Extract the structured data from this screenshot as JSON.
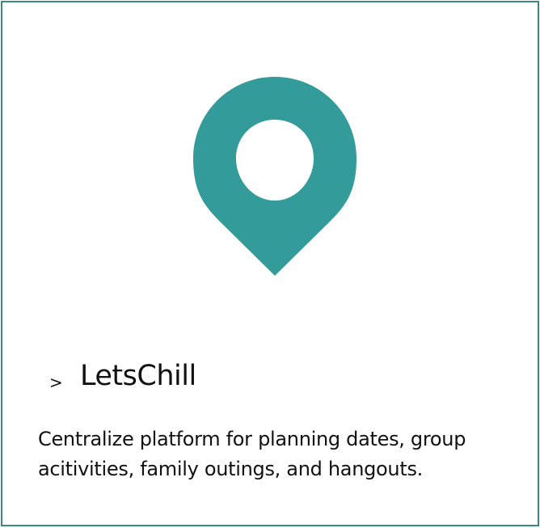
{
  "card": {
    "icon": "map-pin-icon",
    "chevron": ">",
    "title": "LetsChill",
    "description": "Centralize platform for planning dates, group acitivities, family outings, and hangouts."
  },
  "colors": {
    "accent": "#339b99",
    "border": "#3a8a80",
    "text": "#111111",
    "background": "#ffffff"
  }
}
